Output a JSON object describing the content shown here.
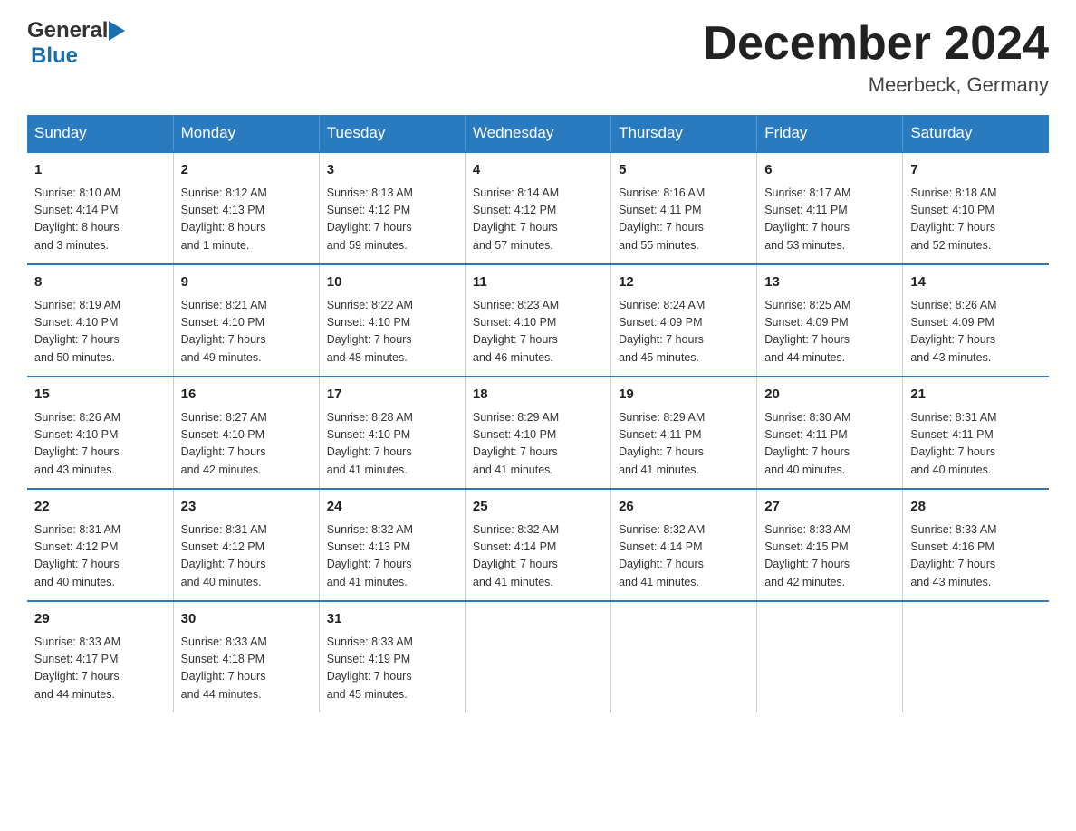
{
  "header": {
    "logo_general": "General",
    "logo_blue": "Blue",
    "month_title": "December 2024",
    "location": "Meerbeck, Germany"
  },
  "days_of_week": [
    "Sunday",
    "Monday",
    "Tuesday",
    "Wednesday",
    "Thursday",
    "Friday",
    "Saturday"
  ],
  "weeks": [
    [
      {
        "day": "1",
        "sunrise": "Sunrise: 8:10 AM",
        "sunset": "Sunset: 4:14 PM",
        "daylight": "Daylight: 8 hours",
        "daylight2": "and 3 minutes."
      },
      {
        "day": "2",
        "sunrise": "Sunrise: 8:12 AM",
        "sunset": "Sunset: 4:13 PM",
        "daylight": "Daylight: 8 hours",
        "daylight2": "and 1 minute."
      },
      {
        "day": "3",
        "sunrise": "Sunrise: 8:13 AM",
        "sunset": "Sunset: 4:12 PM",
        "daylight": "Daylight: 7 hours",
        "daylight2": "and 59 minutes."
      },
      {
        "day": "4",
        "sunrise": "Sunrise: 8:14 AM",
        "sunset": "Sunset: 4:12 PM",
        "daylight": "Daylight: 7 hours",
        "daylight2": "and 57 minutes."
      },
      {
        "day": "5",
        "sunrise": "Sunrise: 8:16 AM",
        "sunset": "Sunset: 4:11 PM",
        "daylight": "Daylight: 7 hours",
        "daylight2": "and 55 minutes."
      },
      {
        "day": "6",
        "sunrise": "Sunrise: 8:17 AM",
        "sunset": "Sunset: 4:11 PM",
        "daylight": "Daylight: 7 hours",
        "daylight2": "and 53 minutes."
      },
      {
        "day": "7",
        "sunrise": "Sunrise: 8:18 AM",
        "sunset": "Sunset: 4:10 PM",
        "daylight": "Daylight: 7 hours",
        "daylight2": "and 52 minutes."
      }
    ],
    [
      {
        "day": "8",
        "sunrise": "Sunrise: 8:19 AM",
        "sunset": "Sunset: 4:10 PM",
        "daylight": "Daylight: 7 hours",
        "daylight2": "and 50 minutes."
      },
      {
        "day": "9",
        "sunrise": "Sunrise: 8:21 AM",
        "sunset": "Sunset: 4:10 PM",
        "daylight": "Daylight: 7 hours",
        "daylight2": "and 49 minutes."
      },
      {
        "day": "10",
        "sunrise": "Sunrise: 8:22 AM",
        "sunset": "Sunset: 4:10 PM",
        "daylight": "Daylight: 7 hours",
        "daylight2": "and 48 minutes."
      },
      {
        "day": "11",
        "sunrise": "Sunrise: 8:23 AM",
        "sunset": "Sunset: 4:10 PM",
        "daylight": "Daylight: 7 hours",
        "daylight2": "and 46 minutes."
      },
      {
        "day": "12",
        "sunrise": "Sunrise: 8:24 AM",
        "sunset": "Sunset: 4:09 PM",
        "daylight": "Daylight: 7 hours",
        "daylight2": "and 45 minutes."
      },
      {
        "day": "13",
        "sunrise": "Sunrise: 8:25 AM",
        "sunset": "Sunset: 4:09 PM",
        "daylight": "Daylight: 7 hours",
        "daylight2": "and 44 minutes."
      },
      {
        "day": "14",
        "sunrise": "Sunrise: 8:26 AM",
        "sunset": "Sunset: 4:09 PM",
        "daylight": "Daylight: 7 hours",
        "daylight2": "and 43 minutes."
      }
    ],
    [
      {
        "day": "15",
        "sunrise": "Sunrise: 8:26 AM",
        "sunset": "Sunset: 4:10 PM",
        "daylight": "Daylight: 7 hours",
        "daylight2": "and 43 minutes."
      },
      {
        "day": "16",
        "sunrise": "Sunrise: 8:27 AM",
        "sunset": "Sunset: 4:10 PM",
        "daylight": "Daylight: 7 hours",
        "daylight2": "and 42 minutes."
      },
      {
        "day": "17",
        "sunrise": "Sunrise: 8:28 AM",
        "sunset": "Sunset: 4:10 PM",
        "daylight": "Daylight: 7 hours",
        "daylight2": "and 41 minutes."
      },
      {
        "day": "18",
        "sunrise": "Sunrise: 8:29 AM",
        "sunset": "Sunset: 4:10 PM",
        "daylight": "Daylight: 7 hours",
        "daylight2": "and 41 minutes."
      },
      {
        "day": "19",
        "sunrise": "Sunrise: 8:29 AM",
        "sunset": "Sunset: 4:11 PM",
        "daylight": "Daylight: 7 hours",
        "daylight2": "and 41 minutes."
      },
      {
        "day": "20",
        "sunrise": "Sunrise: 8:30 AM",
        "sunset": "Sunset: 4:11 PM",
        "daylight": "Daylight: 7 hours",
        "daylight2": "and 40 minutes."
      },
      {
        "day": "21",
        "sunrise": "Sunrise: 8:31 AM",
        "sunset": "Sunset: 4:11 PM",
        "daylight": "Daylight: 7 hours",
        "daylight2": "and 40 minutes."
      }
    ],
    [
      {
        "day": "22",
        "sunrise": "Sunrise: 8:31 AM",
        "sunset": "Sunset: 4:12 PM",
        "daylight": "Daylight: 7 hours",
        "daylight2": "and 40 minutes."
      },
      {
        "day": "23",
        "sunrise": "Sunrise: 8:31 AM",
        "sunset": "Sunset: 4:12 PM",
        "daylight": "Daylight: 7 hours",
        "daylight2": "and 40 minutes."
      },
      {
        "day": "24",
        "sunrise": "Sunrise: 8:32 AM",
        "sunset": "Sunset: 4:13 PM",
        "daylight": "Daylight: 7 hours",
        "daylight2": "and 41 minutes."
      },
      {
        "day": "25",
        "sunrise": "Sunrise: 8:32 AM",
        "sunset": "Sunset: 4:14 PM",
        "daylight": "Daylight: 7 hours",
        "daylight2": "and 41 minutes."
      },
      {
        "day": "26",
        "sunrise": "Sunrise: 8:32 AM",
        "sunset": "Sunset: 4:14 PM",
        "daylight": "Daylight: 7 hours",
        "daylight2": "and 41 minutes."
      },
      {
        "day": "27",
        "sunrise": "Sunrise: 8:33 AM",
        "sunset": "Sunset: 4:15 PM",
        "daylight": "Daylight: 7 hours",
        "daylight2": "and 42 minutes."
      },
      {
        "day": "28",
        "sunrise": "Sunrise: 8:33 AM",
        "sunset": "Sunset: 4:16 PM",
        "daylight": "Daylight: 7 hours",
        "daylight2": "and 43 minutes."
      }
    ],
    [
      {
        "day": "29",
        "sunrise": "Sunrise: 8:33 AM",
        "sunset": "Sunset: 4:17 PM",
        "daylight": "Daylight: 7 hours",
        "daylight2": "and 44 minutes."
      },
      {
        "day": "30",
        "sunrise": "Sunrise: 8:33 AM",
        "sunset": "Sunset: 4:18 PM",
        "daylight": "Daylight: 7 hours",
        "daylight2": "and 44 minutes."
      },
      {
        "day": "31",
        "sunrise": "Sunrise: 8:33 AM",
        "sunset": "Sunset: 4:19 PM",
        "daylight": "Daylight: 7 hours",
        "daylight2": "and 45 minutes."
      },
      null,
      null,
      null,
      null
    ]
  ]
}
